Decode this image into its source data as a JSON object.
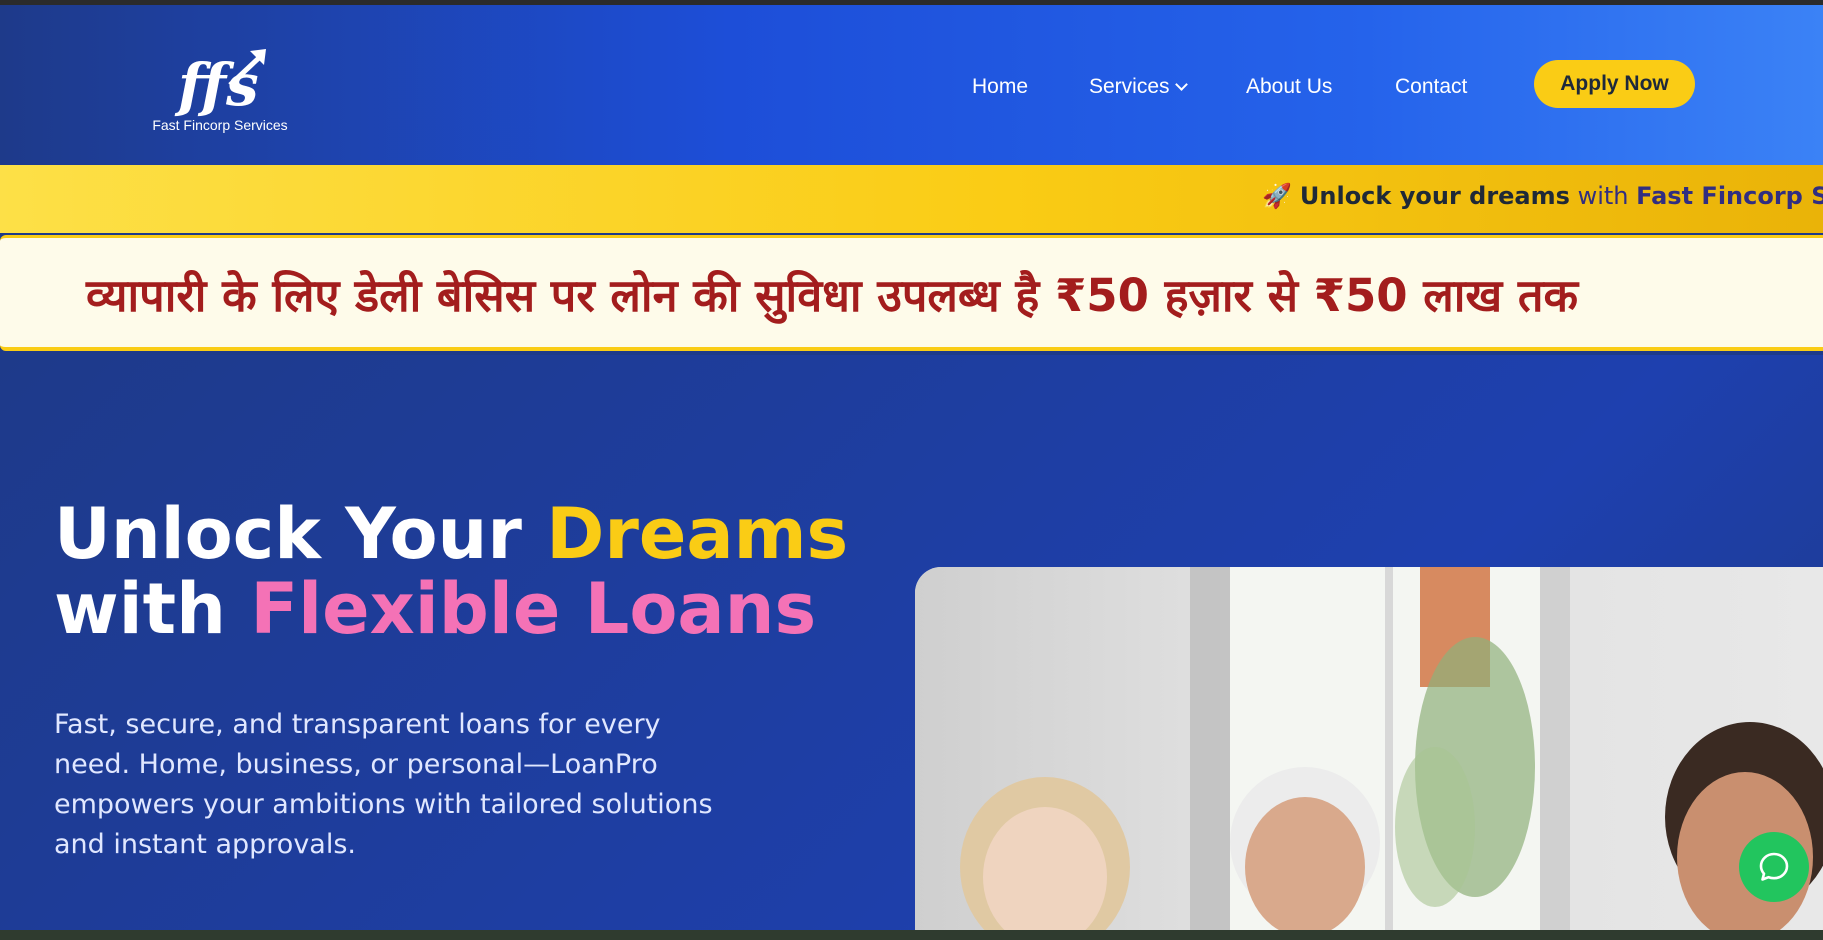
{
  "brand": {
    "logo_icon": "ffs-logo-icon",
    "name": "Fast Fincorp Services"
  },
  "nav": {
    "home": "Home",
    "services": "Services",
    "about": "About Us",
    "contact": "Contact",
    "apply": "Apply Now"
  },
  "ticker": {
    "icon": "rocket-icon",
    "rocket": "🚀",
    "bold": "Unlock your dreams",
    "with": "with",
    "brand": "Fast Fincorp Servic"
  },
  "announcement": {
    "text": "व्यापारी के लिए डेली बेसिस पर लोन की सुविधा उपलब्ध है ₹50 हज़ार से ₹50 लाख तक"
  },
  "hero": {
    "title_line1_white": "Unlock Your ",
    "title_line1_yellow": "Dreams",
    "title_line2_white": "with ",
    "title_line2_pink": "Flexible Loans",
    "description": "Fast, secure, and transparent loans for every need. Home, business, or personal—LoanPro empowers your ambitions with tailored solutions and instant approvals."
  },
  "chat": {
    "icon": "chat-bubble-icon"
  },
  "colors": {
    "accent_yellow": "#facc15",
    "accent_pink": "#f472b6",
    "nav_blue": "#1d4ed8",
    "announcement_red": "#a31d1d",
    "chat_green": "#22c55e"
  }
}
